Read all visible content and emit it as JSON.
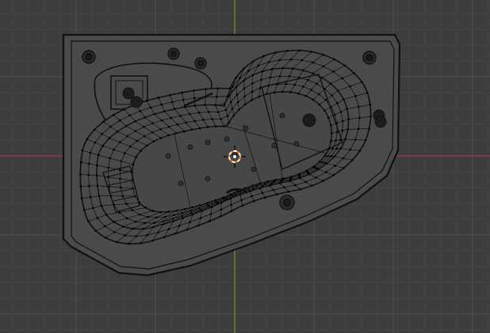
{
  "viewport": {
    "background": "#3d3d3d",
    "grid_minor_color": "#454545",
    "grid_major_color": "#505050",
    "x_axis_color": "#a23a45",
    "y_axis_color": "#6c9a2c",
    "mesh_face_color": "#4a4a4a",
    "mesh_wire_color": "#111111",
    "vertex_color": "#000000"
  },
  "scene": {
    "object": "bathtub-mesh",
    "mode": "wireframe-overlay",
    "cursor_icon": "3d-cursor-icon",
    "cursor_colors": [
      "#ff6a00",
      "#ffffff"
    ],
    "drain_icon": "drain-hole-icon",
    "jet_icon": "jet-nozzle-icon"
  }
}
